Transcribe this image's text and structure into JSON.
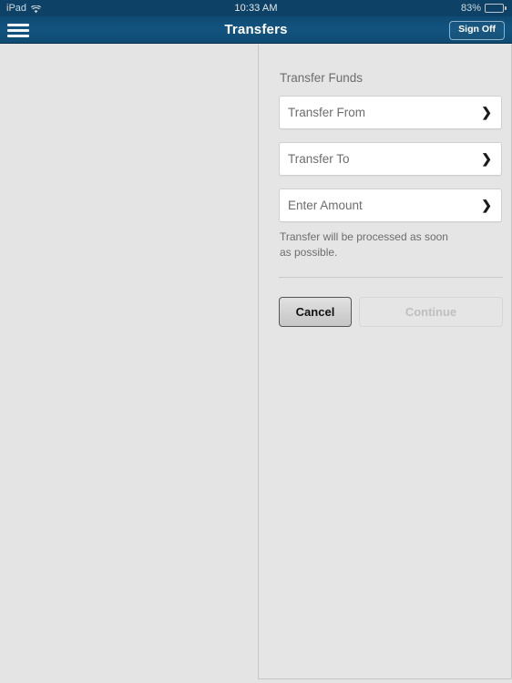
{
  "status_bar": {
    "device": "iPad",
    "wifi_icon": "wifi-icon",
    "time": "10:33 AM",
    "battery_percent": "83%",
    "battery_icon": "battery-icon"
  },
  "navbar": {
    "menu_icon": "hamburger-menu-icon",
    "title": "Transfers",
    "sign_off_label": "Sign Off"
  },
  "main": {
    "section_title": "Transfer Funds",
    "fields": [
      {
        "label": "Transfer From",
        "chevron": "❯"
      },
      {
        "label": "Transfer To",
        "chevron": "❯"
      },
      {
        "label": "Enter Amount",
        "chevron": "❯"
      }
    ],
    "note": "Transfer will be processed as soon as possible.",
    "buttons": {
      "cancel_label": "Cancel",
      "continue_label": "Continue"
    }
  },
  "colors": {
    "navbar_blue": "#12547f",
    "status_blue": "#0d4266",
    "page_background": "#e4e4e4",
    "field_background": "#ffffff",
    "muted_text": "#6d6d6d",
    "disabled_text": "#bfbfbf"
  }
}
